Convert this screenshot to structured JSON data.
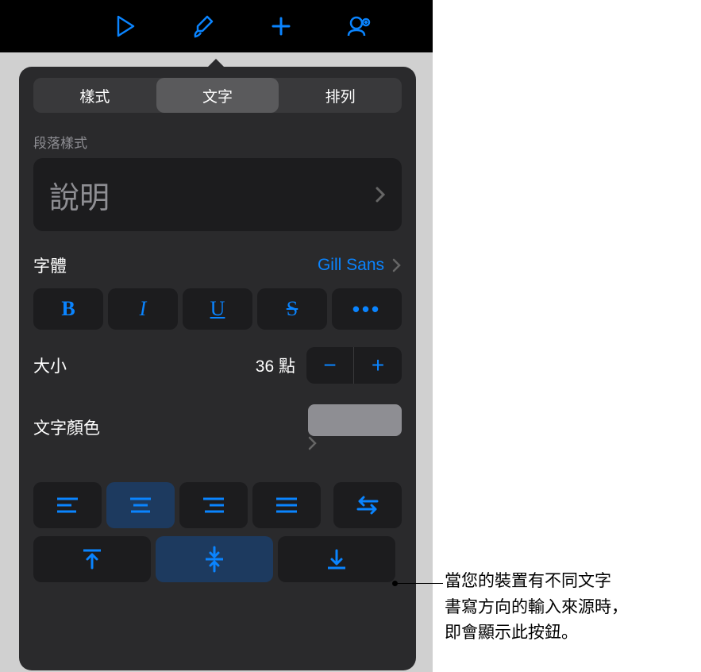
{
  "toolbar": {
    "play": "play-icon",
    "format": "paintbrush-icon",
    "add": "plus-icon",
    "collab": "collaborate-icon"
  },
  "tabs": {
    "style": "樣式",
    "text": "文字",
    "arrange": "排列"
  },
  "paragraph": {
    "label": "段落樣式",
    "value": "說明"
  },
  "font": {
    "label": "字體",
    "value": "Gill Sans"
  },
  "format_buttons": {
    "bold": "B",
    "italic": "I",
    "underline": "U",
    "strike": "S",
    "more": "•••"
  },
  "size": {
    "label": "大小",
    "value": "36 點",
    "minus": "−",
    "plus": "+"
  },
  "color": {
    "label": "文字顏色",
    "swatch": "#8e8e93"
  },
  "callout": {
    "line1": "當您的裝置有不同文字",
    "line2": "書寫方向的輸入來源時，",
    "line3": "即會顯示此按鈕。"
  }
}
